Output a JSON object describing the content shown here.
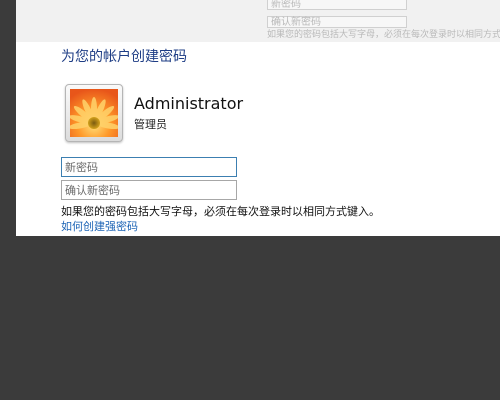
{
  "background_text": {
    "field1": "新密码",
    "field2": "确认新密码",
    "hint": "如果您的密码包括大写字母，必须在每次登录时以相同方式键入。"
  },
  "dialog": {
    "title": "为您的帐户创建密码",
    "user": {
      "name": "Administrator",
      "role": "管理员",
      "avatar_icon": "flower-icon"
    },
    "new_password": {
      "value": "",
      "placeholder": "新密码"
    },
    "confirm_password": {
      "value": "",
      "placeholder": "确认新密码"
    },
    "hint": "如果您的密码包括大写字母，必须在每次登录时以相同方式键入。",
    "strong_password_link": "如何创建强密码"
  },
  "colors": {
    "title": "#1e3d85",
    "link": "#1b63b5",
    "backdrop": "#3b3b3b",
    "panel": "#ffffff",
    "focus_border": "#3c7fb1"
  }
}
